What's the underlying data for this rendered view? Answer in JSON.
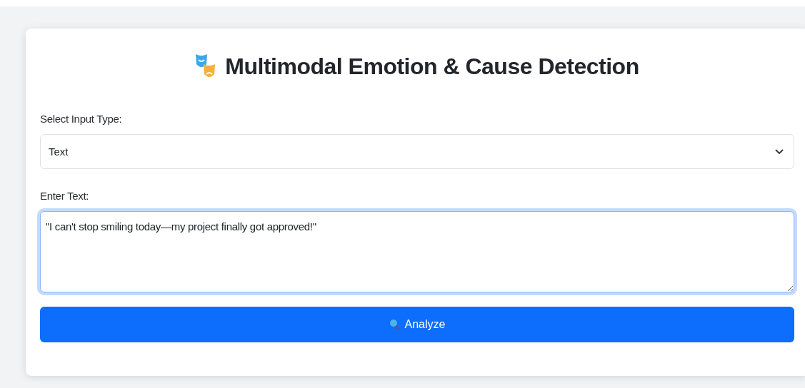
{
  "title": "Multimodal Emotion & Cause Detection",
  "input_type": {
    "label": "Select Input Type:",
    "value": "Text"
  },
  "text_input": {
    "label": "Enter Text:",
    "value": "\"I can't stop smiling today—my project finally got approved!\"",
    "focused": true
  },
  "analyze_button": {
    "label": "Analyze"
  }
}
